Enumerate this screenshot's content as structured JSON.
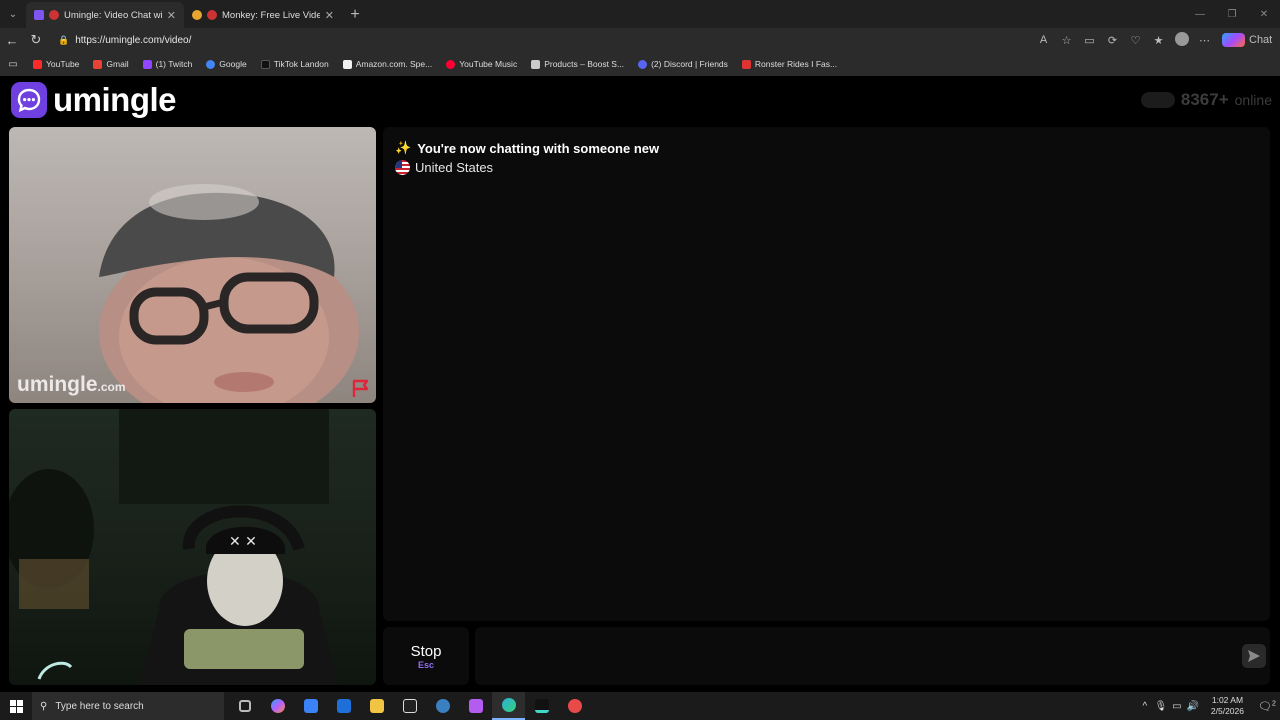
{
  "browser": {
    "tabs": [
      {
        "title": "Umingle: Video Chat with Str",
        "fav_color": "#7e55f0",
        "active": true
      },
      {
        "title": "Monkey: Free Live Video Chat",
        "fav_color": "#e8a530",
        "active": false
      }
    ],
    "new_tab": "+",
    "url": "https://umingle.com/video/",
    "copilot_label": "Chat",
    "bookmarks": [
      {
        "label": "YouTube",
        "color": "#ff2a2a"
      },
      {
        "label": "Gmail",
        "color": "#ea4335"
      },
      {
        "label": "(1) Twitch",
        "color": "#9146ff"
      },
      {
        "label": "Google",
        "color": "#4285f4"
      },
      {
        "label": "TikTok Landon",
        "color": "#222222"
      },
      {
        "label": "Amazon.com. Spe...",
        "color": "#f0f0f0"
      },
      {
        "label": "YouTube Music",
        "color": "#ff0033"
      },
      {
        "label": "Products – Boost S...",
        "color": "#cccccc"
      },
      {
        "label": "(2) Discord | Friends",
        "color": "#5865f2"
      },
      {
        "label": "Ronster Rides I Fas...",
        "color": "#d33"
      }
    ]
  },
  "site": {
    "logo_text": "umingle",
    "online_count": "8367+",
    "online_label": "online",
    "watermark_main": "umingle",
    "watermark_suffix": ".com",
    "chat": {
      "status_icon": "✨",
      "status_text": "You're now chatting with someone new",
      "country": "United States"
    },
    "stop_label": "Stop",
    "stop_shortcut": "Esc",
    "message_value": ""
  },
  "taskbar": {
    "search_placeholder": "Type here to search",
    "time": "1:02 AM",
    "date": "2/5/2026",
    "notification_count": "2",
    "apps": [
      {
        "name": "task-view-icon",
        "color": "#bbbbbb"
      },
      {
        "name": "copilot-icon",
        "color": "#b660ff"
      },
      {
        "name": "microsoft-store-icon",
        "color": "#3b82f6"
      },
      {
        "name": "outlook-icon",
        "color": "#1e6fd9"
      },
      {
        "name": "file-explorer-icon",
        "color": "#f2c443"
      },
      {
        "name": "epic-games-icon",
        "color": "#dddddd"
      },
      {
        "name": "steam-icon",
        "color": "#3a7fc0"
      },
      {
        "name": "xbox-app-icon",
        "color": "#b45cf0"
      },
      {
        "name": "edge-icon",
        "color": "#2bb0d9"
      },
      {
        "name": "terminal-icon",
        "color": "#3fd9c5"
      },
      {
        "name": "recording-app-icon",
        "color": "#e84a4a"
      }
    ]
  }
}
